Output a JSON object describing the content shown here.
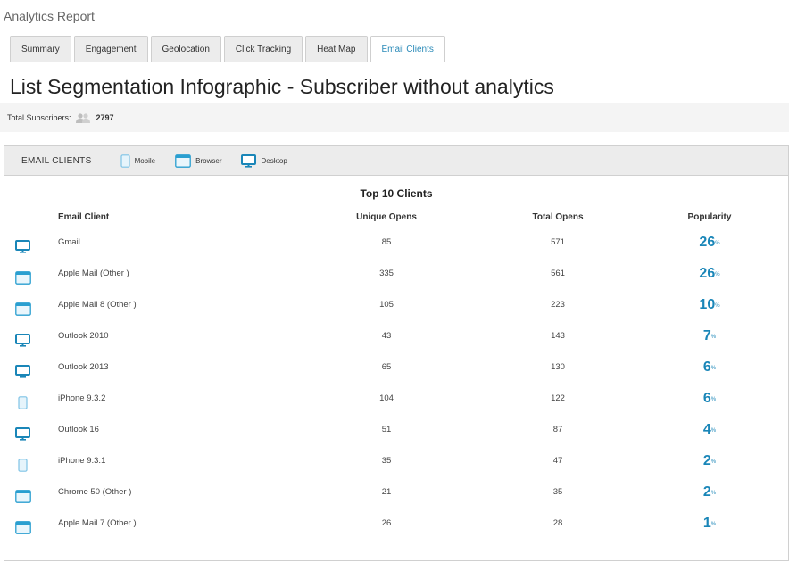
{
  "app": {
    "title": "Analytics Report"
  },
  "tabs": [
    {
      "label": "Summary",
      "active": false
    },
    {
      "label": "Engagement",
      "active": false
    },
    {
      "label": "Geolocation",
      "active": false
    },
    {
      "label": "Click Tracking",
      "active": false
    },
    {
      "label": "Heat Map",
      "active": false
    },
    {
      "label": "Email Clients",
      "active": true
    }
  ],
  "page": {
    "title": "List Segmentation Infographic - Subscriber without analytics",
    "subscribers_label": "Total Subscribers:",
    "subscribers_count": "2797"
  },
  "panel": {
    "title": "EMAIL CLIENTS",
    "legend": [
      {
        "label": "Mobile",
        "icon": "mobile-icon"
      },
      {
        "label": "Browser",
        "icon": "browser-icon"
      },
      {
        "label": "Desktop",
        "icon": "desktop-icon"
      }
    ],
    "section_title": "Top 10 Clients",
    "columns": {
      "client": "Email Client",
      "unique": "Unique Opens",
      "total": "Total Opens",
      "popularity": "Popularity"
    },
    "rows": [
      {
        "device": "desktop-icon",
        "client": "Gmail",
        "unique": "85",
        "total": "571",
        "popularity": "26",
        "unit": "%"
      },
      {
        "device": "browser-icon",
        "client": "Apple Mail (Other )",
        "unique": "335",
        "total": "561",
        "popularity": "26",
        "unit": "%"
      },
      {
        "device": "browser-icon",
        "client": "Apple Mail 8 (Other )",
        "unique": "105",
        "total": "223",
        "popularity": "10",
        "unit": "%"
      },
      {
        "device": "desktop-icon",
        "client": "Outlook 2010",
        "unique": "43",
        "total": "143",
        "popularity": "7",
        "unit": "%"
      },
      {
        "device": "desktop-icon",
        "client": "Outlook 2013",
        "unique": "65",
        "total": "130",
        "popularity": "6",
        "unit": "%"
      },
      {
        "device": "mobile-icon",
        "client": "iPhone 9.3.2",
        "unique": "104",
        "total": "122",
        "popularity": "6",
        "unit": "%"
      },
      {
        "device": "desktop-icon",
        "client": "Outlook 16",
        "unique": "51",
        "total": "87",
        "popularity": "4",
        "unit": "%"
      },
      {
        "device": "mobile-icon",
        "client": "iPhone 9.3.1",
        "unique": "35",
        "total": "47",
        "popularity": "2",
        "unit": "%"
      },
      {
        "device": "browser-icon",
        "client": "Chrome 50 (Other )",
        "unique": "21",
        "total": "35",
        "popularity": "2",
        "unit": "%"
      },
      {
        "device": "browser-icon",
        "client": "Apple Mail 7 (Other )",
        "unique": "26",
        "total": "28",
        "popularity": "1",
        "unit": "%"
      }
    ]
  },
  "colors": {
    "accent": "#1a86b8",
    "tab_active": "#2a8ab8",
    "icon": "#2a9fd0"
  }
}
